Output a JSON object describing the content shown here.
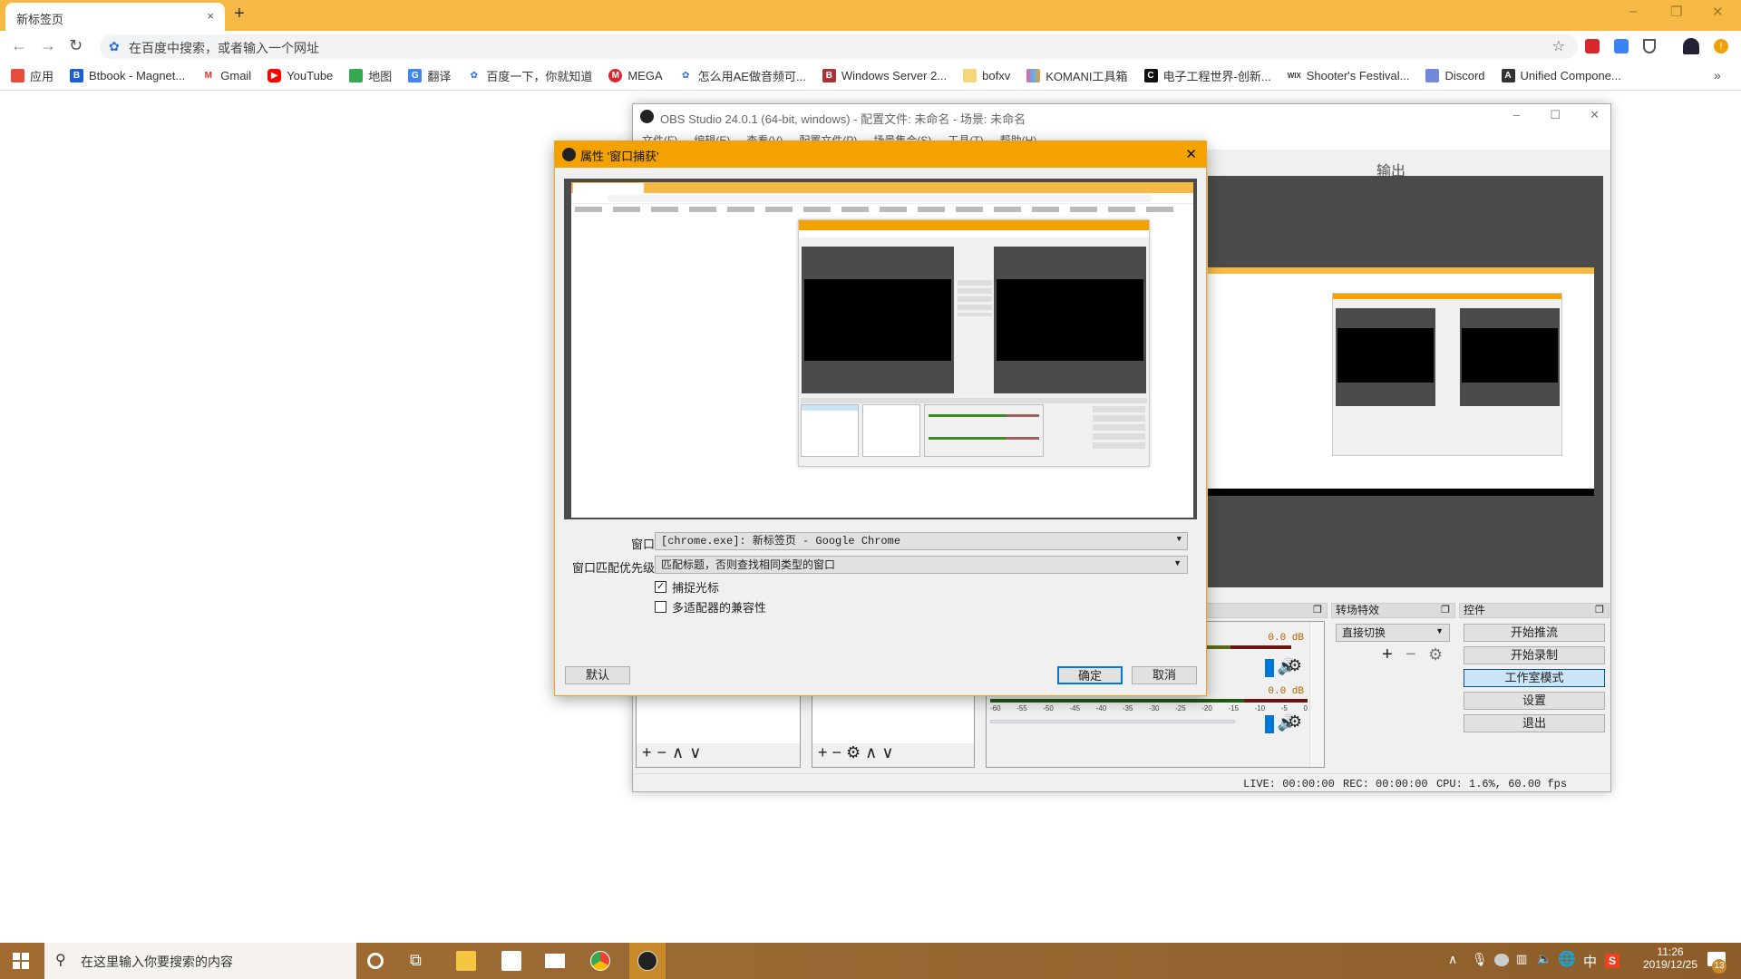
{
  "browser": {
    "tab_title": "新标签页",
    "close_tab": "×",
    "new_tab": "+",
    "window_controls": [
      "–",
      "❐",
      "✕"
    ],
    "omnibox_placeholder": "在百度中搜索，或者输入一个网址",
    "bookmarks": [
      {
        "label": "应用",
        "icon": "apps-grid-icon",
        "color": "#e74c3c"
      },
      {
        "label": "Btbook - Magnet...",
        "icon": "btbook-icon",
        "color": "#1a5fd8"
      },
      {
        "label": "Gmail",
        "icon": "gmail-icon",
        "color": "#d93025"
      },
      {
        "label": "YouTube",
        "icon": "youtube-icon",
        "color": "#ff0000"
      },
      {
        "label": "地图",
        "icon": "maps-icon",
        "color": "#34a853"
      },
      {
        "label": "翻译",
        "icon": "translate-icon",
        "color": "#4285f4"
      },
      {
        "label": "百度一下，你就知道",
        "icon": "baidu-icon",
        "color": "#2e6fe0"
      },
      {
        "label": "MEGA",
        "icon": "mega-icon",
        "color": "#d9272e"
      },
      {
        "label": "怎么用AE做音频可...",
        "icon": "baidu-icon",
        "color": "#2e6fe0"
      },
      {
        "label": "Windows Server 2...",
        "icon": "bookmark-icon",
        "color": "#a33"
      },
      {
        "label": "bofxv",
        "icon": "folder-icon",
        "color": "#f5d77a"
      },
      {
        "label": "KOMANI工具箱",
        "icon": "komani-icon",
        "color": "#e8629a"
      },
      {
        "label": "电子工程世界-创新...",
        "icon": "eeworld-icon",
        "color": "#111"
      },
      {
        "label": "Shooter's Festival...",
        "icon": "wix-icon",
        "color": "#333"
      },
      {
        "label": "Discord",
        "icon": "discord-icon",
        "color": "#7289da"
      },
      {
        "label": "Unified Compone...",
        "icon": "unity-icon",
        "color": "#333"
      }
    ],
    "more_bookmarks": "»"
  },
  "obs": {
    "title": "OBS Studio 24.0.1 (64-bit, windows) - 配置文件: 未命名 - 场景: 未命名",
    "menu": [
      "文件(F)",
      "编辑(E)",
      "查看(V)",
      "配置文件(P)",
      "场景集合(S)",
      "工具(T)",
      "帮助(H)"
    ],
    "output_label": "输出",
    "docks": {
      "transitions": "转场特效",
      "controls": "控件"
    },
    "transition_select": "直接切换",
    "mixer": [
      {
        "db": "0.0 dB"
      },
      {
        "db": "0.0 dB"
      }
    ],
    "meter_ticks": [
      "-60",
      "-55",
      "-50",
      "-45",
      "-40",
      "-35",
      "-30",
      "-25",
      "-20",
      "-15",
      "-10",
      "-5",
      "0"
    ],
    "controls": [
      "开始推流",
      "开始录制",
      "工作室模式",
      "设置",
      "退出"
    ],
    "status": {
      "live": "LIVE: 00:00:00",
      "rec": "REC: 00:00:00",
      "cpu": "CPU: 1.6%, 60.00 fps"
    },
    "colors": {
      "accent": "#f4a200",
      "active_button": "#cce4f7",
      "meter_green": "#5a6a18",
      "meter_red": "#6a1414",
      "volume_blue": "#0078d7"
    }
  },
  "dialog": {
    "title": "属性 '窗口捕获'",
    "close": "✕",
    "window_label": "窗口",
    "window_value": "[chrome.exe]: 新标签页 - Google Chrome",
    "priority_label": "窗口匹配优先级",
    "priority_value": "匹配标题，否则查找相同类型的窗口",
    "capture_cursor": {
      "label": "捕捉光标",
      "checked": true
    },
    "multi_adapter": {
      "label": "多适配器的兼容性",
      "checked": false
    },
    "defaults_button": "默认",
    "ok_button": "确定",
    "cancel_button": "取消"
  },
  "taskbar": {
    "search_placeholder": "在这里输入你要搜索的内容",
    "time": "11:26",
    "date": "2019/12/25",
    "notifications": "13",
    "ime": "中"
  }
}
